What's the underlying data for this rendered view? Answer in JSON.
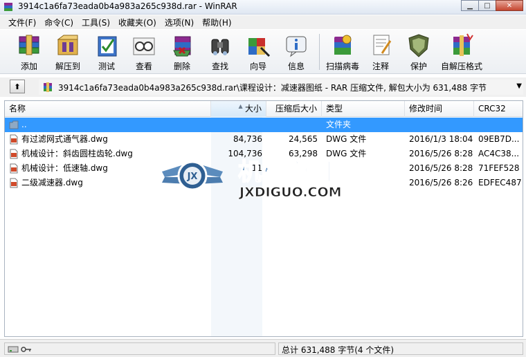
{
  "window": {
    "title": "3914c1a6fa73eada0b4a983a265c938d.rar - WinRAR",
    "minimize_glyph": "▁",
    "maximize_glyph": "□",
    "close_glyph": "✕"
  },
  "menu": [
    "文件(F)",
    "命令(C)",
    "工具(S)",
    "收藏夹(O)",
    "选项(N)",
    "帮助(H)"
  ],
  "toolbar": [
    {
      "label": "添加",
      "icon": "add-archive-icon"
    },
    {
      "label": "解压到",
      "icon": "extract-to-icon"
    },
    {
      "label": "测试",
      "icon": "test-icon"
    },
    {
      "label": "查看",
      "icon": "view-icon"
    },
    {
      "label": "删除",
      "icon": "delete-icon"
    },
    {
      "label": "查找",
      "icon": "find-icon"
    },
    {
      "label": "向导",
      "icon": "wizard-icon"
    },
    {
      "label": "信息",
      "icon": "info-icon"
    },
    {
      "label": "扫描病毒",
      "icon": "virus-scan-icon"
    },
    {
      "label": "注释",
      "icon": "comment-icon"
    },
    {
      "label": "保护",
      "icon": "protect-icon"
    },
    {
      "label": "自解压格式",
      "icon": "sfx-icon"
    }
  ],
  "address": {
    "up_glyph": "⬆",
    "path": "3914c1a6fa73eada0b4a983a265c938d.rar\\课程设计：减速器图纸 - RAR 压缩文件, 解包大小为 631,488 字节",
    "dropdown_glyph": "▼"
  },
  "columns": {
    "name": "名称",
    "size": "大小",
    "packed": "压缩后大小",
    "type": "类型",
    "modified": "修改时间",
    "crc": "CRC32",
    "sort_glyph": "▲"
  },
  "rows": [
    {
      "name": "..",
      "size": "",
      "packed": "",
      "type": "文件夹",
      "modified": "",
      "crc": "",
      "selected": true,
      "kind": "folder"
    },
    {
      "name": "有过滤网式通气器.dwg",
      "size": "84,736",
      "packed": "24,565",
      "type": "DWG 文件",
      "modified": "2016/1/3 18:04",
      "crc": "09EB7D...",
      "selected": false,
      "kind": "file"
    },
    {
      "name": "机械设计：斜齿圆柱齿轮.dwg",
      "size": "104,736",
      "packed": "63,298",
      "type": "DWG 文件",
      "modified": "2016/5/26 8:28",
      "crc": "AC4C38...",
      "selected": false,
      "kind": "file"
    },
    {
      "name": "机械设计：低速轴.dwg",
      "size": "11",
      "packed": "",
      "type": "",
      "modified": "2016/5/26 8:28",
      "crc": "71FEF528",
      "selected": false,
      "kind": "file"
    },
    {
      "name": "二级减速器.dwg",
      "size": "",
      "packed": "",
      "type": "",
      "modified": "2016/5/26 8:26",
      "crc": "EDFEC487",
      "selected": false,
      "kind": "file"
    }
  ],
  "watermark": {
    "badge": "JX",
    "title": "机械帝国",
    "url": "JXDIGUO.COM"
  },
  "status": {
    "total": "总计 631,488 字节(4 个文件)"
  }
}
